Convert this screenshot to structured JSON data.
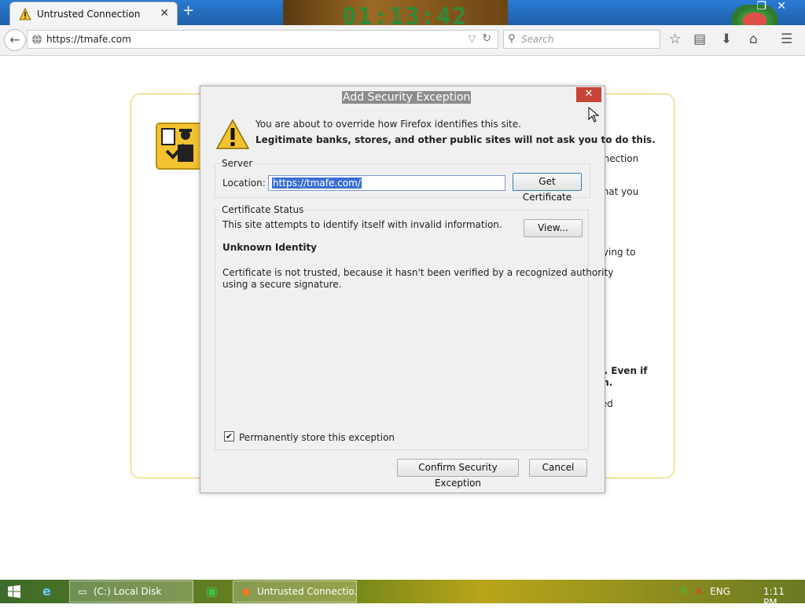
{
  "browser": {
    "tab_title": "Untrusted Connection",
    "url": "https://tmafe.com",
    "search_placeholder": "Search",
    "background_clock": "01:13:42"
  },
  "page_behind": {
    "fragments": [
      "nnection",
      "that you",
      "rying to",
      "n. Even if",
      "on.",
      "ted"
    ]
  },
  "dialog": {
    "title": "Add Security Exception",
    "message_line1": "You are about to override how Firefox identifies this site.",
    "message_line2": "Legitimate banks, stores, and other public sites will not ask you to do this.",
    "server_legend": "Server",
    "location_label": "Location:",
    "location_value": "https://tmafe.com/",
    "get_certificate_label": "Get Certificate",
    "cert_status_legend": "Certificate Status",
    "cert_status_text": "This site attempts to identify itself with invalid information.",
    "view_label": "View...",
    "identity_heading": "Unknown Identity",
    "identity_detail_line1": "Certificate is not trusted, because it hasn't been verified by a recognized authority",
    "identity_detail_line2": "using a secure signature.",
    "permanent_label": "Permanently store this exception",
    "permanent_checked": true,
    "confirm_label": "Confirm Security Exception",
    "cancel_label": "Cancel"
  },
  "taskbar": {
    "local_disk_label": "(C:) Local Disk",
    "firefox_label": "Untrusted Connectio...",
    "language": "ENG",
    "time": "1:11 PM"
  },
  "colors": {
    "accent_blue": "#1f5fa8",
    "dialog_close": "#c94438",
    "warning_yellow": "#f0c94b",
    "selection": "#3a6fd0"
  }
}
